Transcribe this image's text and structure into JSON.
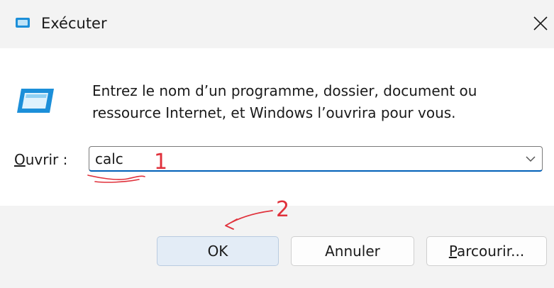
{
  "window": {
    "title": "Exécuter",
    "close_glyph": "✕",
    "title_icon": "run-dialog-icon"
  },
  "dialog": {
    "description": "Entrez le nom d’un programme, dossier, document ou ressource Internet, et Windows l’ouvrira pour vous.",
    "open_label_mnemonic": "O",
    "open_label_rest": "uvrir :",
    "open_value": "calc",
    "dropdown_icon": "chevron-down-icon"
  },
  "buttons": {
    "ok": "OK",
    "cancel": "Annuler",
    "browse_mnemonic": "P",
    "browse_rest": "arcourir..."
  },
  "annotations": {
    "step1": "1",
    "step2": "2",
    "color": "#e0313b"
  },
  "colors": {
    "focus_accent": "#005fb8",
    "icon_blue": "#1c8fd9"
  }
}
